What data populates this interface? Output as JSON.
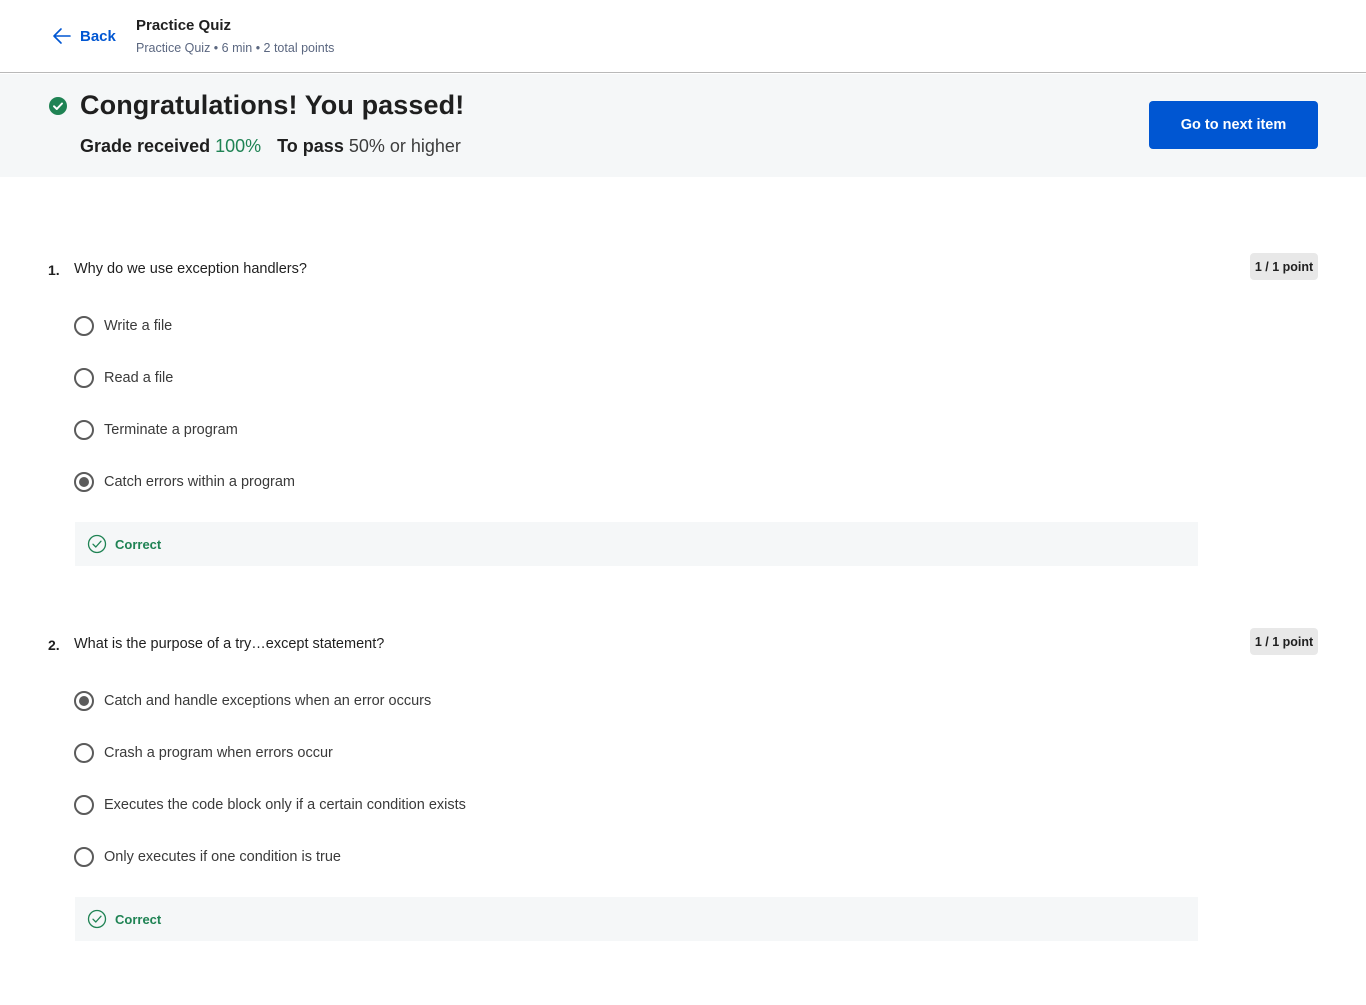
{
  "header": {
    "back_label": "Back",
    "title": "Practice Quiz",
    "meta": "Practice Quiz • 6 min • 2 total points"
  },
  "result": {
    "title": "Congratulations! You passed!",
    "grade_label": "Grade received",
    "grade_value": "100%",
    "pass_label": "To pass",
    "pass_value": "50% or higher",
    "next_button": "Go to next item",
    "accent_color": "#1f8354"
  },
  "questions": [
    {
      "number": "1.",
      "text": "Why do we use exception handlers?",
      "points": "1 / 1 point",
      "options": [
        {
          "label": "Write a file",
          "selected": false
        },
        {
          "label": "Read a file",
          "selected": false
        },
        {
          "label": "Terminate a program",
          "selected": false
        },
        {
          "label": "Catch errors within a program",
          "selected": true
        }
      ],
      "feedback": "Correct"
    },
    {
      "number": "2.",
      "text": "What is the purpose of a try…except statement?",
      "points": "1 / 1 point",
      "options": [
        {
          "label": "Catch and handle exceptions when an error occurs",
          "selected": true
        },
        {
          "label": "Crash a program when errors occur",
          "selected": false
        },
        {
          "label": "Executes the code block only if a certain condition exists",
          "selected": false
        },
        {
          "label": "Only executes if one condition is true",
          "selected": false
        }
      ],
      "feedback": "Correct"
    }
  ],
  "colors": {
    "brand_blue": "#0056d2",
    "success_green": "#1f8354",
    "banner_bg": "#f5f7f8"
  }
}
